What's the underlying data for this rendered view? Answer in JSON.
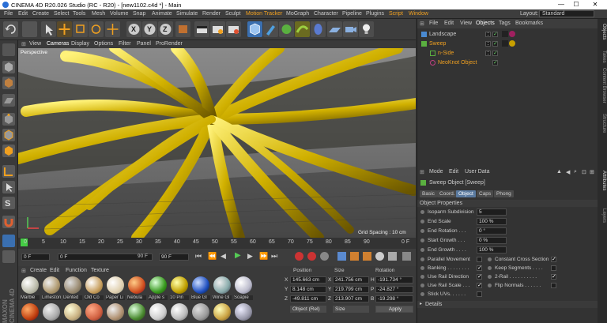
{
  "app": {
    "title": "CINEMA 4D R20.026 Studio (RC - R20) - [new1102.c4d *] - Main",
    "min": "—",
    "max": "☐",
    "close": "✕"
  },
  "menu": [
    "File",
    "Edit",
    "Create",
    "Select",
    "Tools",
    "Mesh",
    "Volume",
    "Snap",
    "Animate",
    "Simulate",
    "Render",
    "Sculpt",
    "Motion Tracker",
    "MoGraph",
    "Character",
    "Pipeline",
    "Plugins",
    "Script",
    "Window"
  ],
  "layout": {
    "label": "Layout:",
    "value": "Standard"
  },
  "viewport": {
    "menu": [
      "View",
      "Cameras",
      "Display",
      "Options",
      "Filter",
      "Panel",
      "ProRender"
    ],
    "name": "Perspective",
    "grid": "Grid Spacing : 10 cm"
  },
  "timeline": {
    "ticks": [
      "0",
      "5",
      "10",
      "15",
      "20",
      "25",
      "30",
      "35",
      "40",
      "45",
      "50",
      "55",
      "60",
      "65",
      "70",
      "75",
      "80",
      "85",
      "90"
    ],
    "end": "0 F"
  },
  "anim": {
    "f1": "0 F",
    "f2": "0 F",
    "f3": "90 F",
    "f4": "90 F"
  },
  "materials": {
    "menu": [
      "Create",
      "Edit",
      "Function",
      "Texture"
    ],
    "names": [
      "Marble",
      "Limestone",
      "Dented",
      "Old Co",
      "Paper Li",
      "Nebula",
      "Apple s",
      "10 Pin",
      "Blue Gl",
      "Wine Gl",
      "Soapie"
    ]
  },
  "coord": {
    "headers": [
      "Position",
      "Size",
      "Rotation"
    ],
    "rows": [
      [
        "X",
        "145.663 cm",
        "X",
        "241.756 cm",
        "H",
        "-191.734 °"
      ],
      [
        "Y",
        "8.148 cm",
        "Y",
        "219.799 cm",
        "P",
        "-24.827 °"
      ],
      [
        "Z",
        "-49.811 cm",
        "Z",
        "213.907 cm",
        "B",
        "-19.298 °"
      ]
    ],
    "mode": "Object (Rel)",
    "size": "Size",
    "apply": "Apply"
  },
  "objects": {
    "menu": [
      "File",
      "Edit",
      "View",
      "Objects",
      "Tags",
      "Bookmarks"
    ],
    "items": [
      "Landscape",
      "Sweep",
      "n-Side",
      "NeoKnot Object"
    ]
  },
  "attr": {
    "menu": [
      "Mode",
      "Edit",
      "User Data"
    ],
    "title": "Sweep Object [Sweep]",
    "tabs": [
      "Basic",
      "Coord.",
      "Object",
      "Caps",
      "Phong"
    ],
    "section": "Object Properties",
    "props": [
      [
        "Isoparm Subdivision",
        "5"
      ],
      [
        "End Scale",
        "100 %"
      ],
      [
        "End Rotation . . .",
        "0 °"
      ],
      [
        "Start Growth . . .",
        "0 %"
      ],
      [
        "End Growth . . . .",
        "100 %"
      ]
    ],
    "checks_left": [
      "Parallel Movement",
      "Banking . . . . . . . .",
      "Use Rail Direction",
      "Use Rail Scale . . .",
      "Stick UVs. . . . . ."
    ],
    "checks_right": [
      "Constant Cross Section",
      "Keep Segments . . . .",
      "2-Rail . . . . . . . . . .",
      "Flip Normals . . . . . ."
    ],
    "details": "Details"
  },
  "strip": [
    "Objects",
    "Takes",
    "Content Browser",
    "Structure",
    "Attributes",
    "Layers"
  ],
  "colors": {
    "accent": "#f0a020",
    "viewport": "#6f6f6f"
  }
}
